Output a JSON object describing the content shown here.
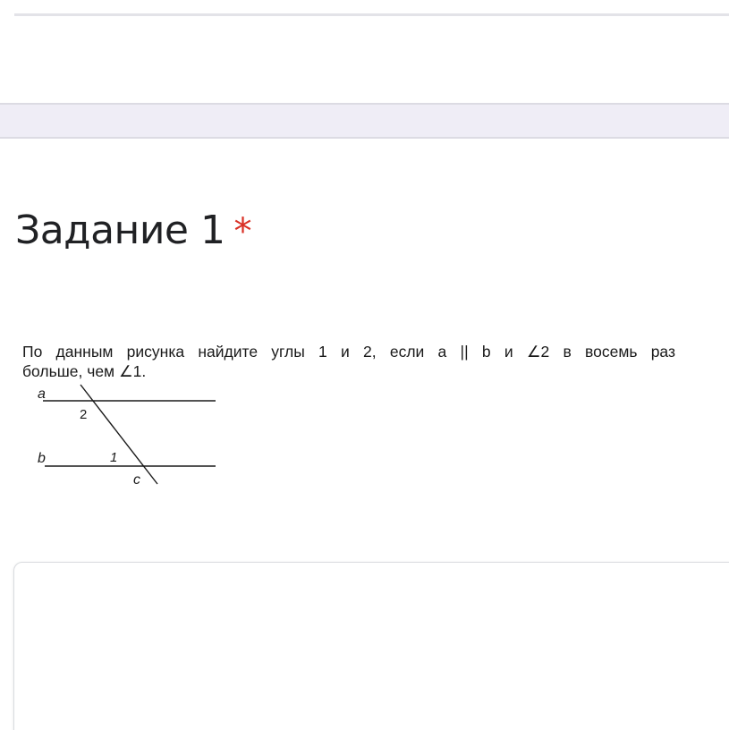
{
  "question": {
    "title": "Задание 1",
    "required_mark": "*",
    "text_line1": "По данным рисунка найдите углы  1 и 2, если a || b и ∠2 в восемь раз",
    "text_line2": "больше, чем ∠1."
  },
  "figure": {
    "label_a": "a",
    "label_b": "b",
    "label_c": "c",
    "label_angle1": "1",
    "label_angle2": "2"
  },
  "colors": {
    "required": "#d93025",
    "band": "#efedf6",
    "text": "#202124"
  }
}
